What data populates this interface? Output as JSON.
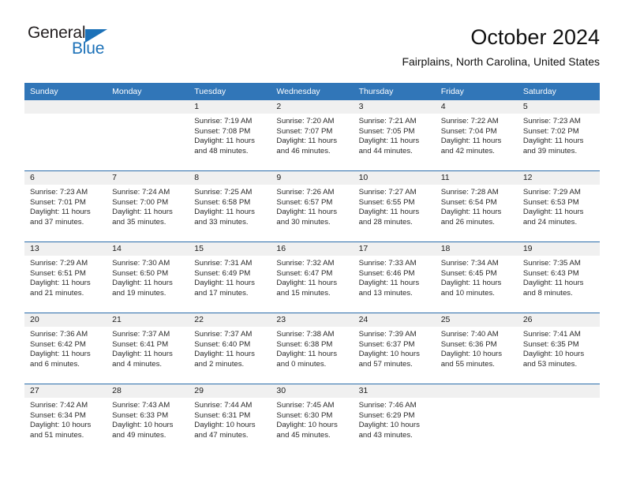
{
  "logo": {
    "line1": "General",
    "line2": "Blue",
    "triangle_color": "#1c71b8",
    "text_color": "#231f20"
  },
  "header": {
    "title": "October 2024",
    "subtitle": "Fairplains, North Carolina, United States"
  },
  "theme": {
    "header_blue": "#3176b8",
    "row_separator": "#2b6cab",
    "day_strip_gray": "#f0f0f0"
  },
  "calendar": {
    "weekday_headers": [
      "Sunday",
      "Monday",
      "Tuesday",
      "Wednesday",
      "Thursday",
      "Friday",
      "Saturday"
    ],
    "weeks": [
      [
        {
          "blank": true
        },
        {
          "blank": true
        },
        {
          "day": "1",
          "sunrise": "Sunrise: 7:19 AM",
          "sunset": "Sunset: 7:08 PM",
          "daylight_1": "Daylight: 11 hours",
          "daylight_2": "and 48 minutes."
        },
        {
          "day": "2",
          "sunrise": "Sunrise: 7:20 AM",
          "sunset": "Sunset: 7:07 PM",
          "daylight_1": "Daylight: 11 hours",
          "daylight_2": "and 46 minutes."
        },
        {
          "day": "3",
          "sunrise": "Sunrise: 7:21 AM",
          "sunset": "Sunset: 7:05 PM",
          "daylight_1": "Daylight: 11 hours",
          "daylight_2": "and 44 minutes."
        },
        {
          "day": "4",
          "sunrise": "Sunrise: 7:22 AM",
          "sunset": "Sunset: 7:04 PM",
          "daylight_1": "Daylight: 11 hours",
          "daylight_2": "and 42 minutes."
        },
        {
          "day": "5",
          "sunrise": "Sunrise: 7:23 AM",
          "sunset": "Sunset: 7:02 PM",
          "daylight_1": "Daylight: 11 hours",
          "daylight_2": "and 39 minutes."
        }
      ],
      [
        {
          "day": "6",
          "sunrise": "Sunrise: 7:23 AM",
          "sunset": "Sunset: 7:01 PM",
          "daylight_1": "Daylight: 11 hours",
          "daylight_2": "and 37 minutes."
        },
        {
          "day": "7",
          "sunrise": "Sunrise: 7:24 AM",
          "sunset": "Sunset: 7:00 PM",
          "daylight_1": "Daylight: 11 hours",
          "daylight_2": "and 35 minutes."
        },
        {
          "day": "8",
          "sunrise": "Sunrise: 7:25 AM",
          "sunset": "Sunset: 6:58 PM",
          "daylight_1": "Daylight: 11 hours",
          "daylight_2": "and 33 minutes."
        },
        {
          "day": "9",
          "sunrise": "Sunrise: 7:26 AM",
          "sunset": "Sunset: 6:57 PM",
          "daylight_1": "Daylight: 11 hours",
          "daylight_2": "and 30 minutes."
        },
        {
          "day": "10",
          "sunrise": "Sunrise: 7:27 AM",
          "sunset": "Sunset: 6:55 PM",
          "daylight_1": "Daylight: 11 hours",
          "daylight_2": "and 28 minutes."
        },
        {
          "day": "11",
          "sunrise": "Sunrise: 7:28 AM",
          "sunset": "Sunset: 6:54 PM",
          "daylight_1": "Daylight: 11 hours",
          "daylight_2": "and 26 minutes."
        },
        {
          "day": "12",
          "sunrise": "Sunrise: 7:29 AM",
          "sunset": "Sunset: 6:53 PM",
          "daylight_1": "Daylight: 11 hours",
          "daylight_2": "and 24 minutes."
        }
      ],
      [
        {
          "day": "13",
          "sunrise": "Sunrise: 7:29 AM",
          "sunset": "Sunset: 6:51 PM",
          "daylight_1": "Daylight: 11 hours",
          "daylight_2": "and 21 minutes."
        },
        {
          "day": "14",
          "sunrise": "Sunrise: 7:30 AM",
          "sunset": "Sunset: 6:50 PM",
          "daylight_1": "Daylight: 11 hours",
          "daylight_2": "and 19 minutes."
        },
        {
          "day": "15",
          "sunrise": "Sunrise: 7:31 AM",
          "sunset": "Sunset: 6:49 PM",
          "daylight_1": "Daylight: 11 hours",
          "daylight_2": "and 17 minutes."
        },
        {
          "day": "16",
          "sunrise": "Sunrise: 7:32 AM",
          "sunset": "Sunset: 6:47 PM",
          "daylight_1": "Daylight: 11 hours",
          "daylight_2": "and 15 minutes."
        },
        {
          "day": "17",
          "sunrise": "Sunrise: 7:33 AM",
          "sunset": "Sunset: 6:46 PM",
          "daylight_1": "Daylight: 11 hours",
          "daylight_2": "and 13 minutes."
        },
        {
          "day": "18",
          "sunrise": "Sunrise: 7:34 AM",
          "sunset": "Sunset: 6:45 PM",
          "daylight_1": "Daylight: 11 hours",
          "daylight_2": "and 10 minutes."
        },
        {
          "day": "19",
          "sunrise": "Sunrise: 7:35 AM",
          "sunset": "Sunset: 6:43 PM",
          "daylight_1": "Daylight: 11 hours",
          "daylight_2": "and 8 minutes."
        }
      ],
      [
        {
          "day": "20",
          "sunrise": "Sunrise: 7:36 AM",
          "sunset": "Sunset: 6:42 PM",
          "daylight_1": "Daylight: 11 hours",
          "daylight_2": "and 6 minutes."
        },
        {
          "day": "21",
          "sunrise": "Sunrise: 7:37 AM",
          "sunset": "Sunset: 6:41 PM",
          "daylight_1": "Daylight: 11 hours",
          "daylight_2": "and 4 minutes."
        },
        {
          "day": "22",
          "sunrise": "Sunrise: 7:37 AM",
          "sunset": "Sunset: 6:40 PM",
          "daylight_1": "Daylight: 11 hours",
          "daylight_2": "and 2 minutes."
        },
        {
          "day": "23",
          "sunrise": "Sunrise: 7:38 AM",
          "sunset": "Sunset: 6:38 PM",
          "daylight_1": "Daylight: 11 hours",
          "daylight_2": "and 0 minutes."
        },
        {
          "day": "24",
          "sunrise": "Sunrise: 7:39 AM",
          "sunset": "Sunset: 6:37 PM",
          "daylight_1": "Daylight: 10 hours",
          "daylight_2": "and 57 minutes."
        },
        {
          "day": "25",
          "sunrise": "Sunrise: 7:40 AM",
          "sunset": "Sunset: 6:36 PM",
          "daylight_1": "Daylight: 10 hours",
          "daylight_2": "and 55 minutes."
        },
        {
          "day": "26",
          "sunrise": "Sunrise: 7:41 AM",
          "sunset": "Sunset: 6:35 PM",
          "daylight_1": "Daylight: 10 hours",
          "daylight_2": "and 53 minutes."
        }
      ],
      [
        {
          "day": "27",
          "sunrise": "Sunrise: 7:42 AM",
          "sunset": "Sunset: 6:34 PM",
          "daylight_1": "Daylight: 10 hours",
          "daylight_2": "and 51 minutes."
        },
        {
          "day": "28",
          "sunrise": "Sunrise: 7:43 AM",
          "sunset": "Sunset: 6:33 PM",
          "daylight_1": "Daylight: 10 hours",
          "daylight_2": "and 49 minutes."
        },
        {
          "day": "29",
          "sunrise": "Sunrise: 7:44 AM",
          "sunset": "Sunset: 6:31 PM",
          "daylight_1": "Daylight: 10 hours",
          "daylight_2": "and 47 minutes."
        },
        {
          "day": "30",
          "sunrise": "Sunrise: 7:45 AM",
          "sunset": "Sunset: 6:30 PM",
          "daylight_1": "Daylight: 10 hours",
          "daylight_2": "and 45 minutes."
        },
        {
          "day": "31",
          "sunrise": "Sunrise: 7:46 AM",
          "sunset": "Sunset: 6:29 PM",
          "daylight_1": "Daylight: 10 hours",
          "daylight_2": "and 43 minutes."
        },
        {
          "blank": true
        },
        {
          "blank": true
        }
      ]
    ]
  }
}
